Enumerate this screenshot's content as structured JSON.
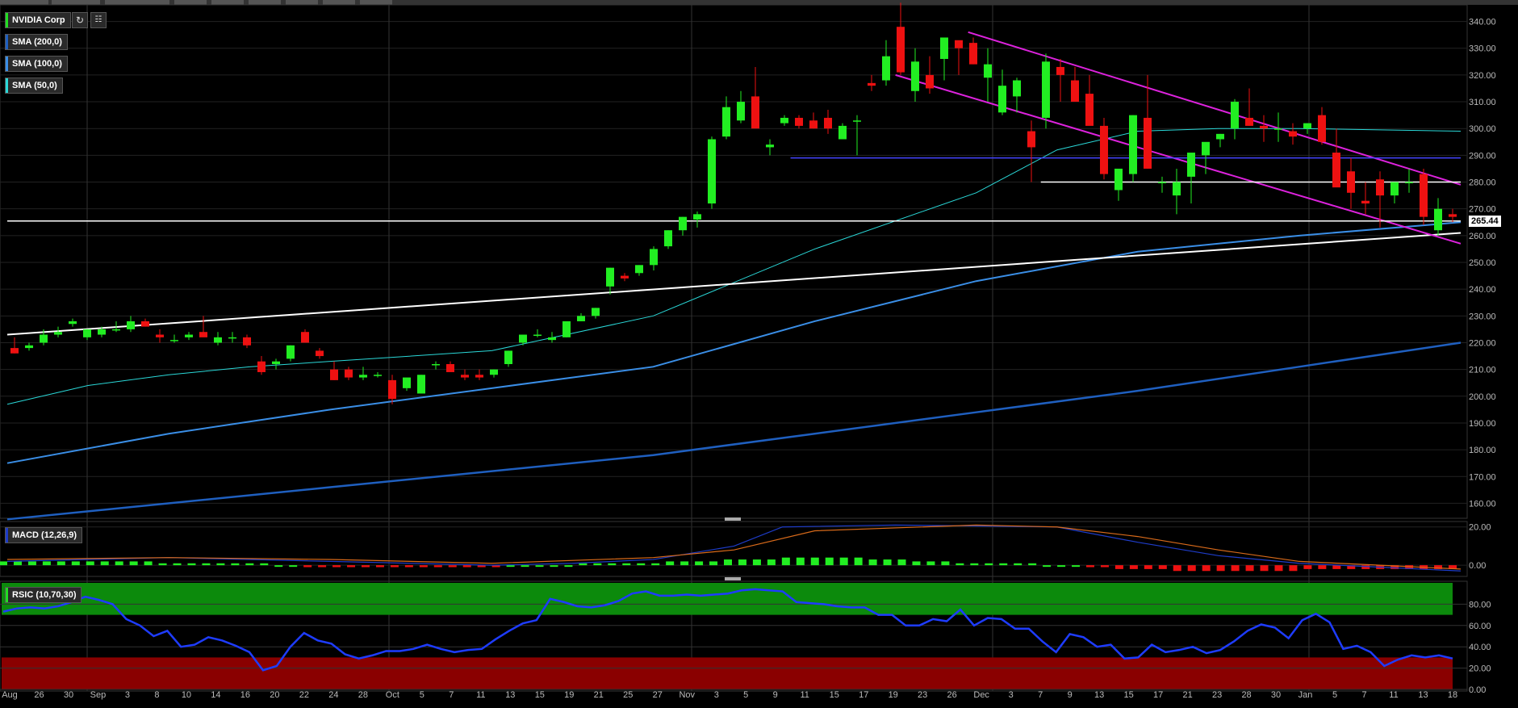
{
  "instrument": {
    "name": "NVIDIA Corp",
    "color": "#22dd22"
  },
  "toolbar": {
    "refresh_icon": "refresh-icon",
    "settings_icon": "chart-settings-icon"
  },
  "indicators": [
    {
      "label": "SMA (200,0)",
      "color": "#1f5fbf"
    },
    {
      "label": "SMA (100,0)",
      "color": "#3a8ee6"
    },
    {
      "label": "SMA (50,0)",
      "color": "#2ad8d8"
    }
  ],
  "last_price_label": "265.44",
  "macd": {
    "label": "MACD (12,26,9)",
    "ticks": [
      "20.00",
      "0.00"
    ],
    "color": "#1e3cc8"
  },
  "rsi": {
    "label": "RSIC (10,70,30)",
    "ticks": [
      "80.00",
      "60.00",
      "40.00",
      "20.00",
      "0.00"
    ],
    "color": "#1e3cff"
  },
  "colors": {
    "up": "#22ee22",
    "down": "#ee1111",
    "overbought": "#0c8a0c",
    "oversold": "#8a0000",
    "channel": "#dd22dd"
  },
  "chart_data": [
    {
      "type": "candlestick",
      "title": "NVIDIA Corp",
      "x_tick_labels": [
        "Aug",
        "26",
        "30",
        "Sep",
        "3",
        "8",
        "10",
        "14",
        "16",
        "20",
        "22",
        "24",
        "28",
        "Oct",
        "5",
        "7",
        "11",
        "13",
        "15",
        "19",
        "21",
        "25",
        "27",
        "Nov",
        "3",
        "5",
        "9",
        "11",
        "15",
        "17",
        "19",
        "23",
        "26",
        "Dec",
        "3",
        "7",
        "9",
        "13",
        "15",
        "17",
        "21",
        "23",
        "28",
        "30",
        "Jan",
        "5",
        "7",
        "11",
        "13",
        "18"
      ],
      "y_tick_labels": [
        "340.00",
        "330.00",
        "320.00",
        "310.00",
        "300.00",
        "290.00",
        "280.00",
        "270.00",
        "260.00",
        "250.00",
        "240.00",
        "230.00",
        "220.00",
        "210.00",
        "200.00",
        "190.00",
        "180.00",
        "170.00",
        "160.00"
      ],
      "ylim": [
        155,
        345
      ],
      "candles": [
        [
          218,
          222,
          216,
          216
        ],
        [
          218,
          220,
          217,
          219
        ],
        [
          220,
          225,
          219,
          223
        ],
        [
          223,
          226,
          222,
          224
        ],
        [
          227,
          229,
          226,
          228
        ],
        [
          222,
          225,
          221,
          225
        ],
        [
          223,
          226,
          222,
          225
        ],
        [
          225,
          228,
          224,
          225
        ],
        [
          225,
          230,
          224,
          228
        ],
        [
          228,
          229,
          226,
          226
        ],
        [
          223,
          225,
          220,
          222
        ],
        [
          221,
          223,
          220,
          221
        ],
        [
          222,
          224,
          221,
          223
        ],
        [
          224,
          230,
          223,
          222
        ],
        [
          220,
          224,
          219,
          222
        ],
        [
          222,
          224,
          220,
          222
        ],
        [
          222,
          223,
          218,
          219
        ],
        [
          213,
          215,
          208,
          209
        ],
        [
          212,
          214,
          210,
          213
        ],
        [
          214,
          219,
          213,
          219
        ],
        [
          224,
          225,
          220,
          220
        ],
        [
          217,
          218,
          214,
          215
        ],
        [
          210,
          213,
          206,
          206
        ],
        [
          210,
          211,
          206,
          207
        ],
        [
          207,
          211,
          206,
          208
        ],
        [
          208,
          209,
          207,
          208
        ],
        [
          206,
          208,
          197,
          199
        ],
        [
          203,
          206,
          202,
          207
        ],
        [
          201,
          208,
          201,
          208
        ],
        [
          212,
          213,
          210,
          212
        ],
        [
          212,
          213,
          210,
          209
        ],
        [
          208,
          210,
          206,
          207
        ],
        [
          208,
          210,
          206,
          207
        ],
        [
          208,
          210,
          207,
          210
        ],
        [
          212,
          217,
          211,
          217
        ],
        [
          220,
          223,
          219,
          223
        ],
        [
          223,
          225,
          222,
          223
        ],
        [
          221,
          224,
          220,
          222
        ],
        [
          222,
          228,
          222,
          228
        ],
        [
          228,
          231,
          228,
          230
        ],
        [
          230,
          233,
          229,
          233
        ],
        [
          241,
          248,
          238,
          248
        ],
        [
          245,
          246,
          243,
          244
        ],
        [
          246,
          249,
          245,
          249
        ],
        [
          249,
          256,
          247,
          255
        ],
        [
          256,
          262,
          255,
          262
        ],
        [
          262,
          267,
          260,
          267
        ],
        [
          266,
          269,
          263,
          268
        ],
        [
          272,
          297,
          270,
          296
        ],
        [
          297,
          312,
          296,
          308
        ],
        [
          303,
          314,
          302,
          310
        ],
        [
          312,
          323,
          310,
          300
        ],
        [
          293,
          296,
          290,
          294
        ],
        [
          302,
          305,
          301,
          304
        ],
        [
          304,
          305,
          300,
          301
        ],
        [
          303,
          306,
          300,
          300
        ],
        [
          304,
          307,
          298,
          300
        ],
        [
          296,
          302,
          296,
          301
        ],
        [
          303,
          305,
          290,
          303
        ],
        [
          317,
          320,
          314,
          316
        ],
        [
          318,
          333,
          316,
          327
        ],
        [
          338,
          347,
          320,
          321
        ],
        [
          314,
          330,
          310,
          325
        ],
        [
          320,
          327,
          313,
          315
        ],
        [
          326,
          330,
          318,
          334
        ],
        [
          333,
          330,
          320,
          330
        ],
        [
          332,
          334,
          324,
          324
        ],
        [
          319,
          330,
          310,
          324
        ],
        [
          306,
          322,
          305,
          316
        ],
        [
          312,
          319,
          306,
          318
        ],
        [
          299,
          303,
          280,
          293
        ],
        [
          304,
          328,
          300,
          325
        ],
        [
          323,
          326,
          310,
          320
        ],
        [
          318,
          323,
          312,
          310
        ],
        [
          313,
          320,
          305,
          301
        ],
        [
          301,
          304,
          281,
          283
        ],
        [
          277,
          285,
          273,
          285
        ],
        [
          283,
          305,
          280,
          305
        ],
        [
          304,
          320,
          285,
          285
        ],
        [
          280,
          282,
          276,
          280
        ],
        [
          275,
          285,
          268,
          280
        ],
        [
          282,
          290,
          272,
          291
        ],
        [
          290,
          294,
          283,
          295
        ],
        [
          296,
          298,
          293,
          298
        ],
        [
          300,
          311,
          296,
          310
        ],
        [
          304,
          315,
          301,
          301
        ],
        [
          301,
          305,
          295,
          300
        ],
        [
          300,
          306,
          295,
          300
        ],
        [
          299,
          302,
          294,
          297
        ],
        [
          300,
          302,
          298,
          302
        ],
        [
          305,
          308,
          294,
          295
        ],
        [
          291,
          300,
          284,
          278
        ],
        [
          284,
          289,
          270,
          276
        ],
        [
          273,
          280,
          268,
          272
        ],
        [
          281,
          284,
          263,
          275
        ],
        [
          275,
          280,
          272,
          280
        ],
        [
          280,
          285,
          276,
          280
        ],
        [
          283,
          285,
          264,
          267
        ],
        [
          262,
          274,
          260,
          270
        ],
        [
          268,
          270,
          265,
          267
        ]
      ],
      "series": [
        {
          "name": "SMA (200,0)",
          "values": [
            [
              0,
              154
            ],
            [
              40,
              166
            ],
            [
              80,
              178
            ],
            [
              100,
              186
            ],
            [
              120,
              194
            ],
            [
              140,
              202
            ],
            [
              160,
              211
            ],
            [
              180,
              220
            ]
          ]
        },
        {
          "name": "SMA (100,0)",
          "values": [
            [
              0,
              175
            ],
            [
              20,
              186
            ],
            [
              40,
              195
            ],
            [
              60,
              203
            ],
            [
              80,
              211
            ],
            [
              100,
              228
            ],
            [
              120,
              243
            ],
            [
              140,
              254
            ],
            [
              160,
              260
            ],
            [
              180,
              265
            ]
          ]
        },
        {
          "name": "SMA (50,0)",
          "values": [
            [
              0,
              197
            ],
            [
              10,
              204
            ],
            [
              20,
              208
            ],
            [
              30,
              211
            ],
            [
              40,
              213
            ],
            [
              60,
              217
            ],
            [
              80,
              230
            ],
            [
              100,
              255
            ],
            [
              120,
              276
            ],
            [
              130,
              292
            ],
            [
              140,
              299
            ],
            [
              150,
              300
            ],
            [
              160,
              300
            ],
            [
              180,
              299
            ]
          ]
        }
      ],
      "trendlines": [
        {
          "kind": "support",
          "color": "#ffffff",
          "from": [
            0,
            223
          ],
          "to": [
            180,
            261
          ]
        },
        {
          "kind": "channel-top",
          "color": "#dd22dd",
          "from": [
            119,
            336
          ],
          "to": [
            180,
            279
          ]
        },
        {
          "kind": "channel-bottom",
          "color": "#dd22dd",
          "from": [
            110,
            320
          ],
          "to": [
            180,
            257
          ]
        },
        {
          "kind": "horizontal",
          "color": "#4444ff",
          "from": [
            97,
            289
          ],
          "to": [
            180,
            289
          ]
        },
        {
          "kind": "horizontal",
          "color": "#ffffff",
          "from": [
            128,
            280
          ],
          "to": [
            180,
            280
          ]
        },
        {
          "kind": "horizontal",
          "color": "#ffffff",
          "from": [
            0,
            265.44
          ],
          "to": [
            180,
            265.44
          ]
        }
      ],
      "last_value": 265.44
    },
    {
      "type": "bar",
      "title": "MACD (12,26,9)",
      "ylim": [
        -5,
        22
      ],
      "histogram": [
        2,
        2,
        2,
        2,
        2,
        2,
        2,
        2,
        2,
        2,
        2,
        1,
        1,
        1,
        1,
        1,
        1,
        1,
        1,
        0,
        0,
        -1,
        -1,
        -1,
        -1,
        -1,
        -1,
        -1,
        -1,
        -1,
        -1,
        -1,
        -1,
        -1,
        -1,
        0,
        0,
        0,
        0,
        0,
        1,
        1,
        1,
        1,
        1,
        1,
        2,
        2,
        2,
        2,
        3,
        3,
        3,
        3,
        4,
        4,
        4,
        4,
        4,
        4,
        3,
        3,
        3,
        2,
        2,
        2,
        1,
        1,
        1,
        1,
        1,
        1,
        0,
        0,
        0,
        -1,
        -1,
        -2,
        -2,
        -2,
        -2,
        -3,
        -3,
        -3,
        -3,
        -3,
        -3,
        -3,
        -3,
        -3,
        -2,
        -2,
        -2,
        -2,
        -2,
        -2,
        -2,
        -2,
        -2,
        -2,
        -2
      ],
      "series": [
        {
          "name": "MACD",
          "values": [
            [
              0,
              2
            ],
            [
              10,
              3
            ],
            [
              20,
              4
            ],
            [
              30,
              3
            ],
            [
              40,
              2
            ],
            [
              50,
              1
            ],
            [
              60,
              0
            ],
            [
              70,
              1
            ],
            [
              80,
              3
            ],
            [
              90,
              10
            ],
            [
              96,
              20
            ],
            [
              110,
              21
            ],
            [
              130,
              20
            ],
            [
              140,
              12
            ],
            [
              150,
              5
            ],
            [
              160,
              1
            ],
            [
              170,
              -1
            ],
            [
              180,
              -3
            ]
          ]
        },
        {
          "name": "Signal",
          "values": [
            [
              0,
              3
            ],
            [
              20,
              4
            ],
            [
              40,
              3
            ],
            [
              60,
              1
            ],
            [
              80,
              4
            ],
            [
              90,
              8
            ],
            [
              100,
              18
            ],
            [
              120,
              21
            ],
            [
              130,
              20
            ],
            [
              140,
              15
            ],
            [
              150,
              8
            ],
            [
              160,
              2
            ],
            [
              170,
              0
            ],
            [
              180,
              -2
            ]
          ]
        }
      ]
    },
    {
      "type": "line",
      "title": "RSIC (10,70,30)",
      "ylim": [
        0,
        100
      ],
      "bands": {
        "overbought": 70,
        "oversold": 30
      },
      "values": [
        73,
        76,
        77,
        76,
        78,
        82,
        87,
        84,
        80,
        66,
        60,
        50,
        55,
        40,
        42,
        49,
        46,
        41,
        35,
        18,
        22,
        40,
        53,
        46,
        43,
        33,
        29,
        32,
        36,
        36,
        38,
        42,
        38,
        35,
        37,
        38,
        47,
        55,
        62,
        65,
        85,
        82,
        78,
        77,
        79,
        83,
        90,
        92,
        88,
        88,
        89,
        88,
        89,
        90,
        93,
        94,
        93,
        92,
        82,
        81,
        80,
        78,
        77,
        77,
        70,
        70,
        60,
        60,
        66,
        64,
        75,
        60,
        67,
        66,
        57,
        57,
        45,
        35,
        52,
        49,
        40,
        42,
        29,
        30,
        42,
        35,
        37,
        40,
        34,
        37,
        45,
        55,
        61,
        58,
        48,
        65,
        71,
        63,
        38,
        41,
        35,
        22,
        28,
        32,
        30,
        32,
        29
      ]
    }
  ]
}
